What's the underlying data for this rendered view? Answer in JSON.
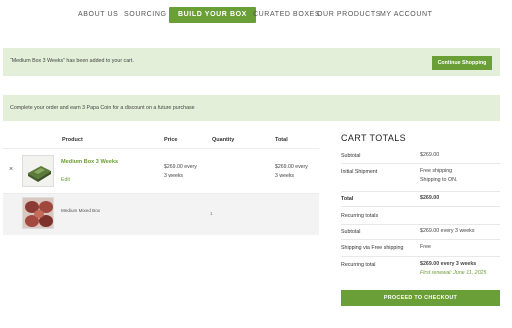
{
  "nav": {
    "items": [
      {
        "label": "ABOUT US",
        "active": false
      },
      {
        "label": "SOURCING",
        "active": false
      },
      {
        "label": "BUILD YOUR BOX",
        "active": true
      },
      {
        "label": "CURATED BOXES",
        "active": false
      },
      {
        "label": "OUR PRODUCTS",
        "active": false
      },
      {
        "label": "MY ACCOUNT",
        "active": false
      }
    ]
  },
  "notices": {
    "added_message": "“Medium Box 3 Weeks” has been added to your cart.",
    "continue_label": "Continue Shopping",
    "coin_message": "Complete your order and earn 3 Papa Coin for a discount on a future purchase"
  },
  "cart": {
    "headers": {
      "product": "Product",
      "price": "Price",
      "quantity": "Quantity",
      "total": "Total"
    },
    "items": [
      {
        "remove_icon": "close-icon",
        "name": "Medium Box 3 Weeks",
        "edit_label": "Edit",
        "price_line1": "$269.00 every",
        "price_line2": "3 weeks",
        "total_line1": "$269.00 every",
        "total_line2": "3 weeks"
      }
    ],
    "sub_items": [
      {
        "name": "Medium Mixed Box",
        "quantity": "1"
      }
    ]
  },
  "totals": {
    "title": "CART TOTALS",
    "rows": [
      {
        "label": "Subtotal",
        "value": "$269.00"
      },
      {
        "label": "Initial Shipment",
        "value": "Free shipping",
        "value2": "Shipping to ON."
      },
      {
        "label": "Total",
        "value": "$269.00"
      },
      {
        "label": "Recurring totals",
        "value": ""
      },
      {
        "label": "Subtotal",
        "value": "$269.00 every 3 weeks"
      },
      {
        "label": "Shipping via Free shipping",
        "value": "Free"
      },
      {
        "label": "Recurring total",
        "value": "$269.00 every 3 weeks",
        "value2": "First renewal: June 11, 2025"
      }
    ],
    "checkout_label": "PROCEED TO CHECKOUT"
  },
  "colors": {
    "accent": "#6a9e36",
    "notice_bg": "#e3efd8"
  }
}
